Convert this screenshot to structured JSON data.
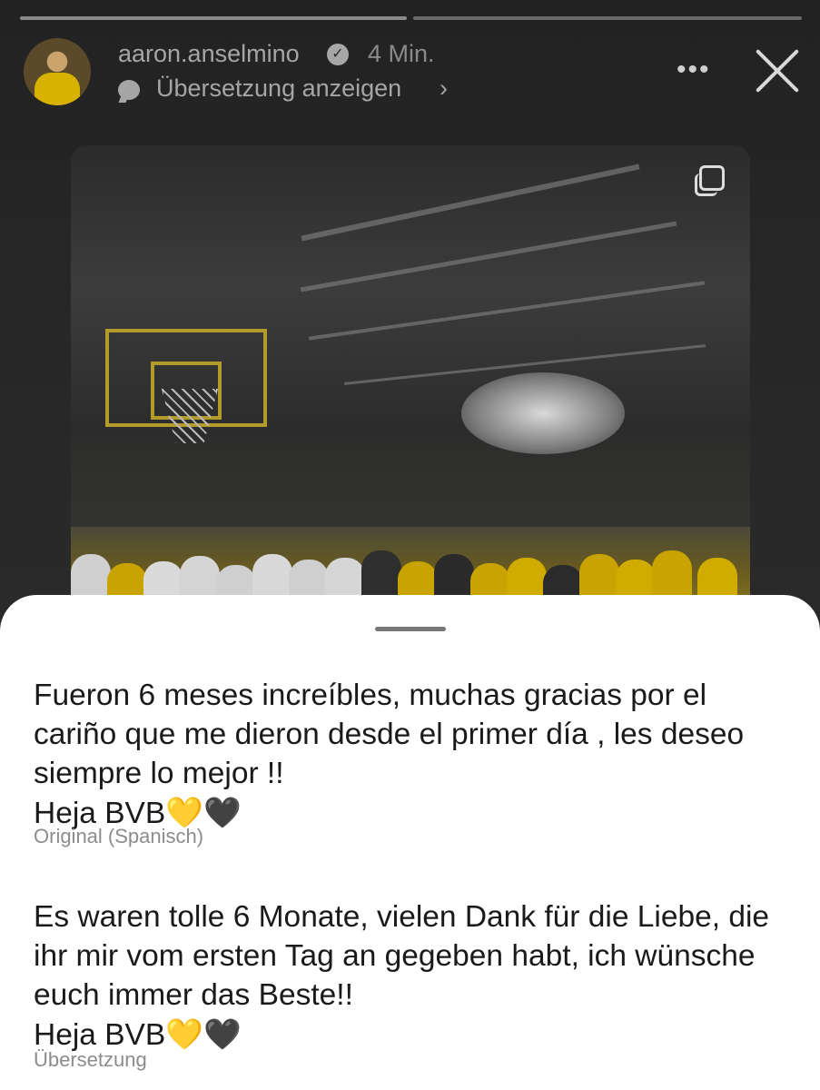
{
  "header": {
    "username": "aaron.anselmino",
    "time_ago": "4 Min.",
    "translate_label": "Übersetzung anzeigen",
    "translate_chevron": "›",
    "more_label": "•••"
  },
  "icons": {
    "verified": "verified-badge-icon",
    "translate": "speech-bubble-icon",
    "close": "close-icon",
    "more": "more-options-icon",
    "multi": "carousel-icon"
  },
  "post": {
    "original_text": "Fueron 6 meses increíbles, muchas gracias por el cariño que me dieron desde el primer día , les deseo siempre lo mejor !!",
    "original_sign": "Heja BVB",
    "original_label": "Original (Spanisch)",
    "translated_text": "Es waren tolle 6 Monate, vielen Dank für die Liebe, die ihr mir vom ersten Tag an gegeben habt, ich wünsche euch immer das Beste!!",
    "translated_sign": "Heja BVB",
    "translated_label": "Übersetzung",
    "heart_yellow": "💛",
    "heart_black": "🖤"
  },
  "colors": {
    "bvb_yellow": "#d9b200",
    "sheet_bg": "#ffffff",
    "story_bg": "#1a1a1a"
  }
}
